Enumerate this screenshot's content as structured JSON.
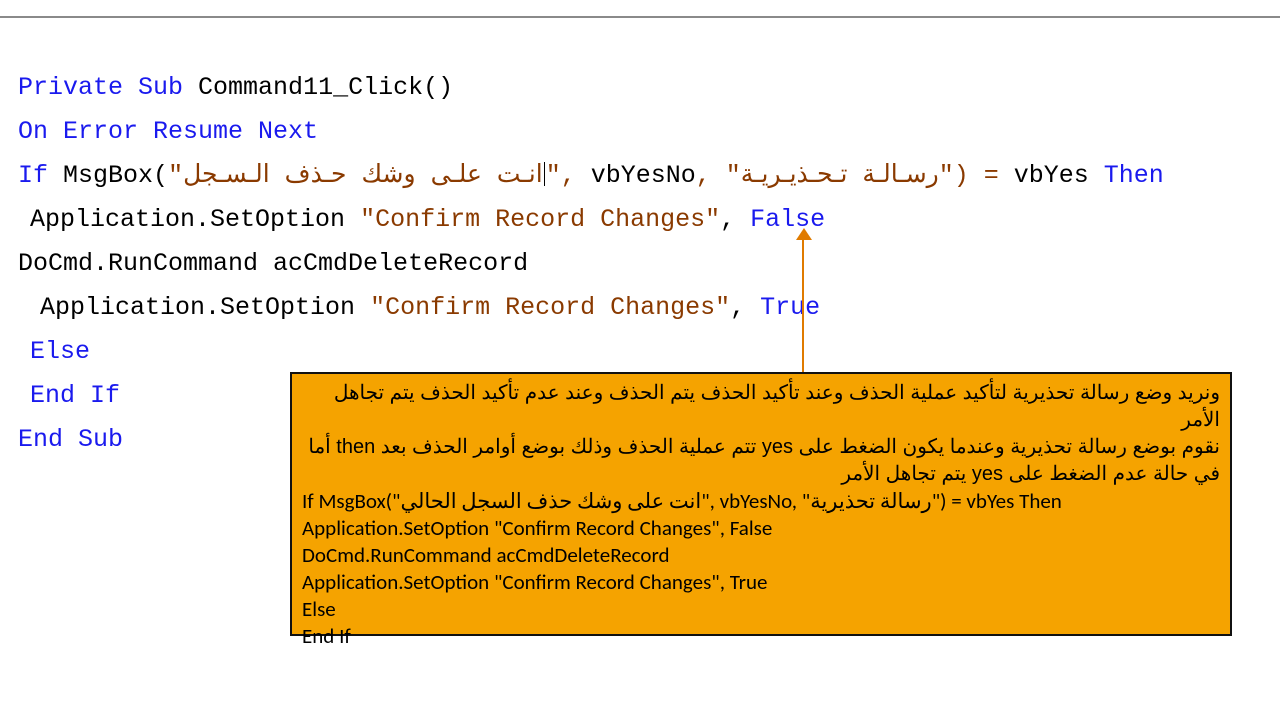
{
  "code": {
    "l1": {
      "private_sub": "Private Sub",
      "name": "Command11_Click()"
    },
    "l2": {
      "on_error": "On Error Resume Next"
    },
    "l3": {
      "if": "If",
      "msgbox": "MsgBox(",
      "q1": "\"",
      "str1_ar": "انـت علـى وشك حـذف الـسـجل",
      "comma1": "\", ",
      "vbyesno": "vbYesNo",
      "comma2": ", \"",
      "str2_ar": "رسـالـة تـحـذيـريـة",
      "close": "\") = ",
      "vbyes": "vbYes",
      "then": " Then"
    },
    "l4": {
      "app_setopt": "Application.SetOption ",
      "str": "\"Confirm Record Changes\"",
      "comma": ", ",
      "false": "False"
    },
    "l5": {
      "docmd": "DoCmd.RunCommand acCmdDeleteRecord"
    },
    "l6": {
      "app_setopt": "Application.SetOption ",
      "str": "\"Confirm Record Changes\"",
      "comma": ", ",
      "true": "True"
    },
    "l7": {
      "else": "Else"
    },
    "l8": {
      "endif": "End If"
    },
    "l9": {
      "endsub": "End Sub"
    }
  },
  "note": {
    "p1": "ونريد وضع رسالة تحذيرية لتأكيد عملية الحذف وعند تأكيد الحذف يتم الحذف وعند عدم تأكيد الحذف يتم تجاهل الأمر",
    "p2": "نقوم بوضع رسالة تحذيرية وعندما يكون الضغط على yes تتم عملية الحذف وذلك بوضع أوامر الحذف بعد then أما في حالة عدم الضغط على yes يتم تجاهل الأمر",
    "c1": "If MsgBox(\"انت على وشك حذف السجل الحالي\", vbYesNo, \"رسالة تحذيرية\") = vbYes Then",
    "c2": " Application.SetOption \"Confirm Record Changes\", False",
    "c3": "DoCmd.RunCommand acCmdDeleteRecord",
    "c4": " Application.SetOption \"Confirm Record Changes\", True",
    "c5": " Else",
    "c6": " End If"
  }
}
